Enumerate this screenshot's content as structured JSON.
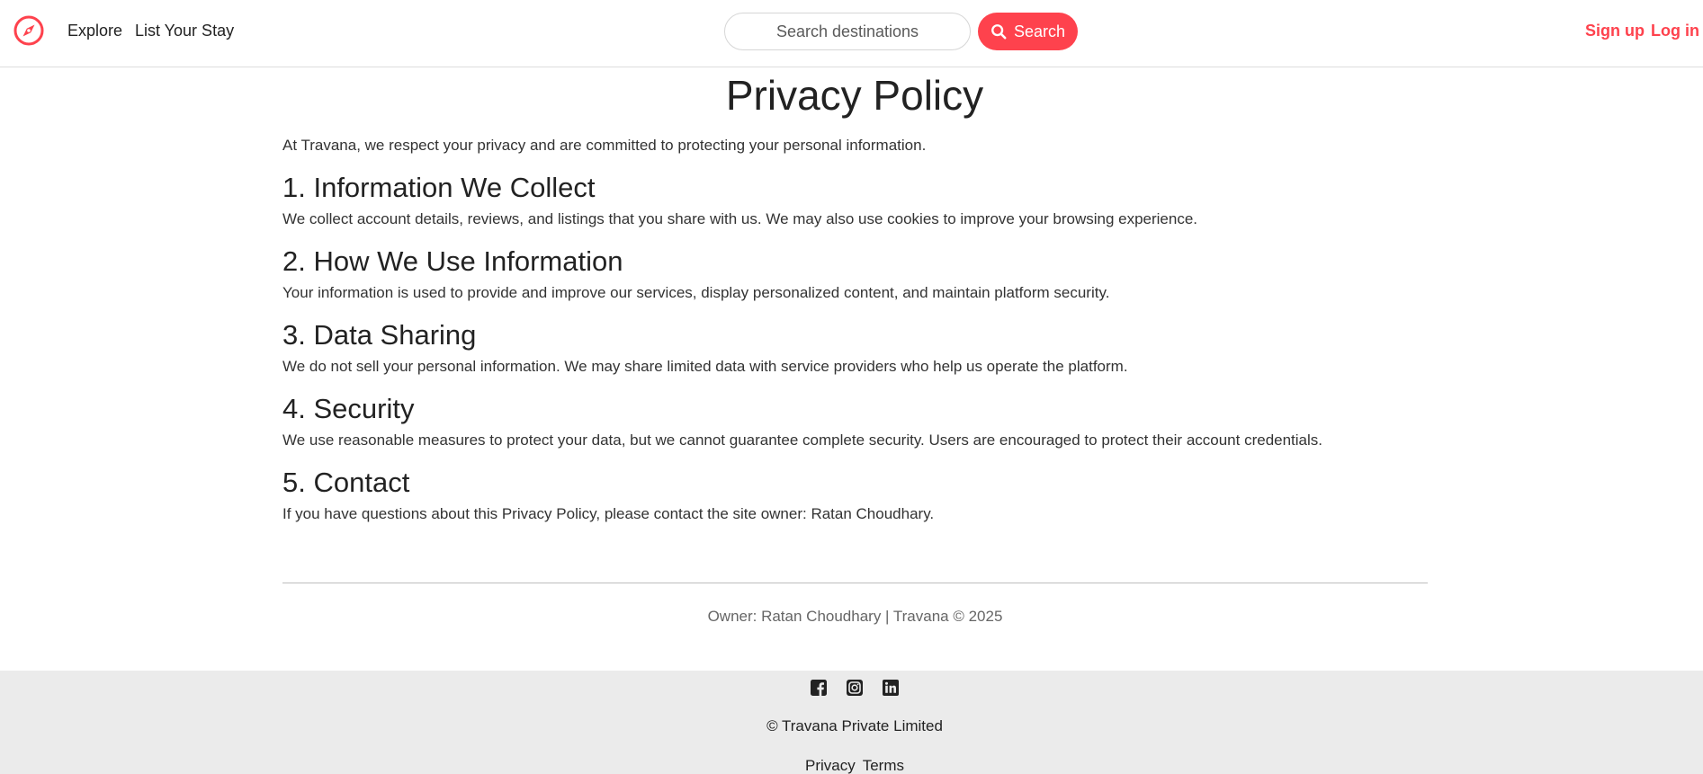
{
  "brand": {
    "accent": "#fe424d",
    "logo_icon": "compass-icon"
  },
  "nav": {
    "links": [
      "Explore",
      "List Your Stay"
    ],
    "search": {
      "placeholder": "Search destinations",
      "value": "",
      "button_label": "Search",
      "button_icon": "search-icon"
    },
    "auth": {
      "signup": "Sign up",
      "login": "Log in"
    }
  },
  "main": {
    "title": "Privacy Policy",
    "intro": "At Travana, we respect your privacy and are committed to protecting your personal information.",
    "sections": [
      {
        "heading": "1. Information We Collect",
        "text": "We collect account details, reviews, and listings that you share with us. We may also use cookies to improve your browsing experience."
      },
      {
        "heading": "2. How We Use Information",
        "text": "Your information is used to provide and improve our services, display personalized content, and maintain platform security."
      },
      {
        "heading": "3. Data Sharing",
        "text": "We do not sell your personal information. We may share limited data with service providers who help us operate the platform."
      },
      {
        "heading": "4. Security",
        "text": "We use reasonable measures to protect your data, but we cannot guarantee complete security. Users are encouraged to protect their account credentials."
      },
      {
        "heading": "5. Contact",
        "text": "If you have questions about this Privacy Policy, please contact the site owner: Ratan Choudhary."
      }
    ],
    "owner_line": "Owner: Ratan Choudhary | Travana © 2025"
  },
  "footer": {
    "social_icons": [
      "facebook-icon",
      "instagram-icon",
      "linkedin-icon"
    ],
    "copyright": "© Travana Private Limited",
    "links": [
      "Privacy",
      "Terms"
    ],
    "background": "#ebebeb"
  }
}
